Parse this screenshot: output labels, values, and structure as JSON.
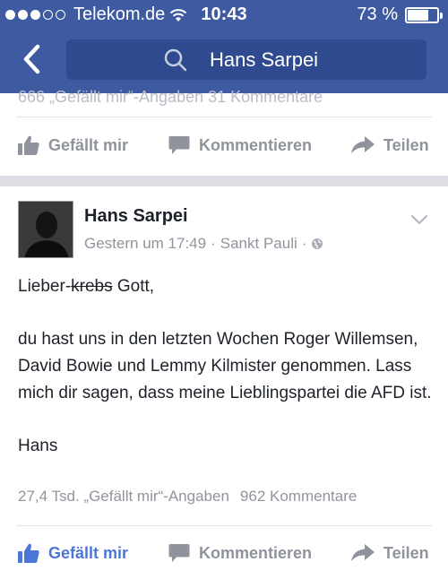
{
  "status_bar": {
    "carrier": "Telekom.de",
    "time": "10:43",
    "battery": "73 %",
    "battery_level": 0.73
  },
  "search": {
    "query": "Hans Sarpei"
  },
  "prev_post": {
    "stats_ghost": "666 „Gefällt mir“-Angaben   31 Kommentare",
    "actions": {
      "like": "Gefällt mir",
      "comment": "Kommentieren",
      "share": "Teilen"
    }
  },
  "post": {
    "author": "Hans Sarpei",
    "time": "Gestern um 17:49",
    "location": "Sankt Pauli",
    "greeting_start": "Lieber-",
    "greeting_strike": "krebs",
    "greeting_end": " Gott,",
    "paragraph": "du hast uns in den letzten Wochen Roger Willemsen, David Bowie und Lemmy Kilmister genommen. Lass mich dir sagen, dass meine Lieblingspartei die AFD ist.",
    "signature": "Hans",
    "likes": "27,4 Tsd. „Gefällt mir“-Angaben",
    "comments": "962 Kommentare",
    "actions": {
      "like": "Gefällt mir",
      "comment": "Kommentieren",
      "share": "Teilen"
    }
  },
  "colors": {
    "header": "#3e5ba2",
    "liked": "#4b77d8",
    "muted": "#90949c"
  }
}
